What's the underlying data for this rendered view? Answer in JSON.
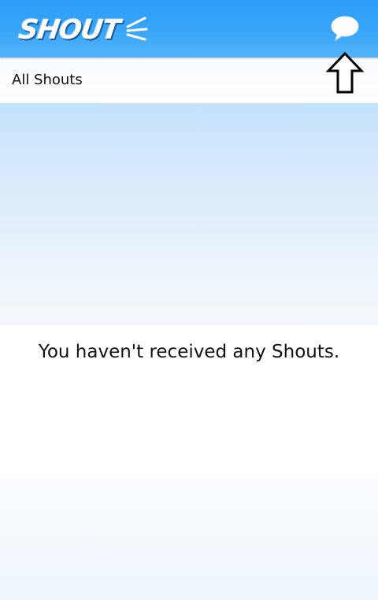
{
  "app_bar": {
    "logo_text": "SHOUT",
    "chat_icon": "speech-bubble-icon",
    "background_color": "#3aa6f8"
  },
  "sub_header": {
    "title": "All Shouts"
  },
  "overlay": {
    "icon": "up-arrow-icon"
  },
  "content": {
    "empty_message": "You haven't received any Shouts."
  }
}
